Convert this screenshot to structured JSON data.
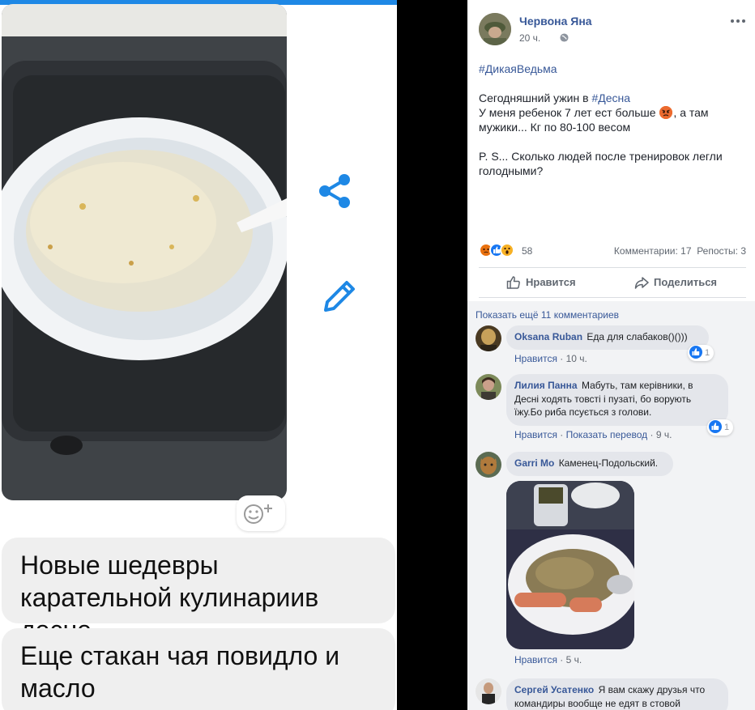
{
  "left_panel": {
    "photo_caption_bubbles": [
      "Новые шедевры карательной кулинариив десне",
      "Еще стакан чая повидло и масло"
    ],
    "icons": {
      "share": "share-icon",
      "edit": "pencil-icon",
      "add_reaction": "add-reaction-icon"
    }
  },
  "post": {
    "author": "Червона Яна",
    "time": "20 ч.",
    "privacy_icon": "globe-icon",
    "hashtag_line": "#ДикаяВедьма",
    "text": {
      "line1_prefix": "Сегодняшний ужин в ",
      "line1_hashtag": "#Десна",
      "line2_prefix": "У меня ребенок 7 лет ест больше ",
      "line2_emoji": "angry-emoji",
      "line2_suffix": ", а там",
      "line3": "мужики... Кг по 80-100 весом",
      "ps_line1": "P. S... Сколько людей после тренировок легли",
      "ps_line2": "голодными?"
    },
    "reactions": {
      "icons": [
        "angry-icon",
        "like-icon",
        "wow-icon"
      ],
      "count": "58"
    },
    "comments_count": "Комментарии: 17",
    "shares_count": "Репосты: 3",
    "actions": {
      "like": "Нравится",
      "share": "Поделиться"
    }
  },
  "comments": {
    "show_more": "Показать ещё 11 комментариев",
    "items": [
      {
        "author": "Oksana Ruban",
        "text": "Еда для слабаков()()))",
        "like_link": "Нравится",
        "time": "10 ч.",
        "likes": "1"
      },
      {
        "author": "Лилия Панна",
        "text_line1": "Мабуть, там керівники, в",
        "text_line2": "Десні ходять товсті і пузаті, бо ворують",
        "text_line3": "їжу.Бо риба псується з голови.",
        "like_link": "Нравится",
        "translate_link": "Показать перевод",
        "time": "9 ч.",
        "likes": "1"
      },
      {
        "author": "Garri Mo",
        "text": "Каменец-Подольский.",
        "like_link": "Нравится",
        "time": "5 ч."
      },
      {
        "author": "Сергей Усатенко",
        "text_line1": "Я вам скажу друзья что",
        "text_line2": "командиры вообще не едят в стовой"
      }
    ]
  },
  "colors": {
    "fb_link": "#385898",
    "fb_text": "#1d2129",
    "fb_meta": "#616770",
    "bubble_bg": "#efefef",
    "share_blue": "#1e88e5"
  }
}
